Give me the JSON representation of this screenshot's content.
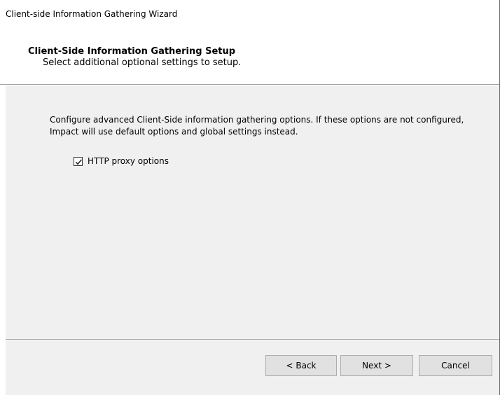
{
  "window": {
    "title": "Client-side Information Gathering Wizard"
  },
  "header": {
    "title": "Client-Side Information Gathering Setup",
    "subtitle": "Select additional optional settings to setup."
  },
  "body": {
    "description": "Configure advanced Client-Side information gathering options. If these options are not configured, Impact will use default options and global settings instead.",
    "checkbox": {
      "label": "HTTP proxy options",
      "checked": true
    }
  },
  "footer": {
    "back_label": "< Back",
    "next_label": "Next >",
    "cancel_label": "Cancel"
  },
  "colors": {
    "window_border": "#1979ca",
    "panel_background": "#f0f0f0",
    "button_background": "#e1e1e1",
    "button_border": "#adadad"
  },
  "icons": {
    "checkbox_mark": "checkmark-icon"
  }
}
